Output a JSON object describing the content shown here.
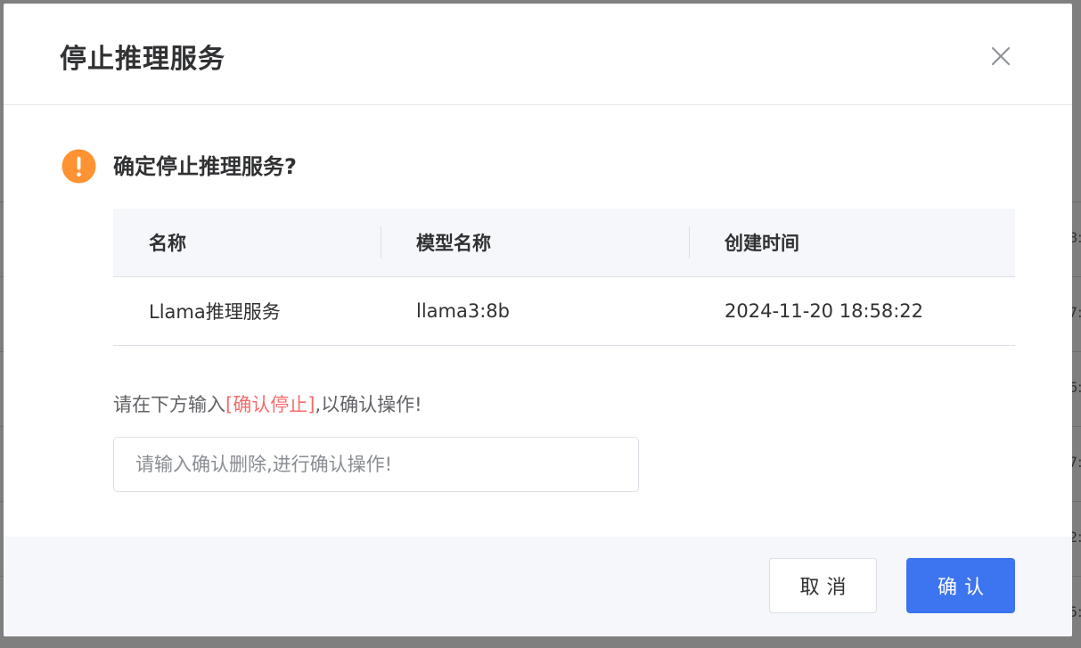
{
  "dialog": {
    "title": "停止推理服务",
    "close_icon": "close-icon",
    "question": "确定停止推理服务?",
    "warning_icon": "exclamation-circle-icon",
    "warning_color": "#ff9232"
  },
  "table": {
    "columns": [
      "名称",
      "模型名称",
      "创建时间"
    ],
    "rows": [
      [
        "Llama推理服务",
        "llama3:8b",
        "2024-11-20 18:58:22"
      ]
    ]
  },
  "instruction": {
    "prefix": "请在下方输入",
    "keyword": "[确认停止]",
    "suffix": ",以确认操作!",
    "keyword_color": "#f56c6c"
  },
  "input": {
    "value": "",
    "placeholder": "请输入确认删除,进行确认操作!"
  },
  "footer": {
    "cancel_label": "取消",
    "confirm_label": "确认",
    "primary_color": "#3d74ef"
  },
  "background": {
    "edge_fragments": [
      "8:",
      "7:",
      "6:",
      "7:",
      "2:",
      "5:"
    ]
  }
}
